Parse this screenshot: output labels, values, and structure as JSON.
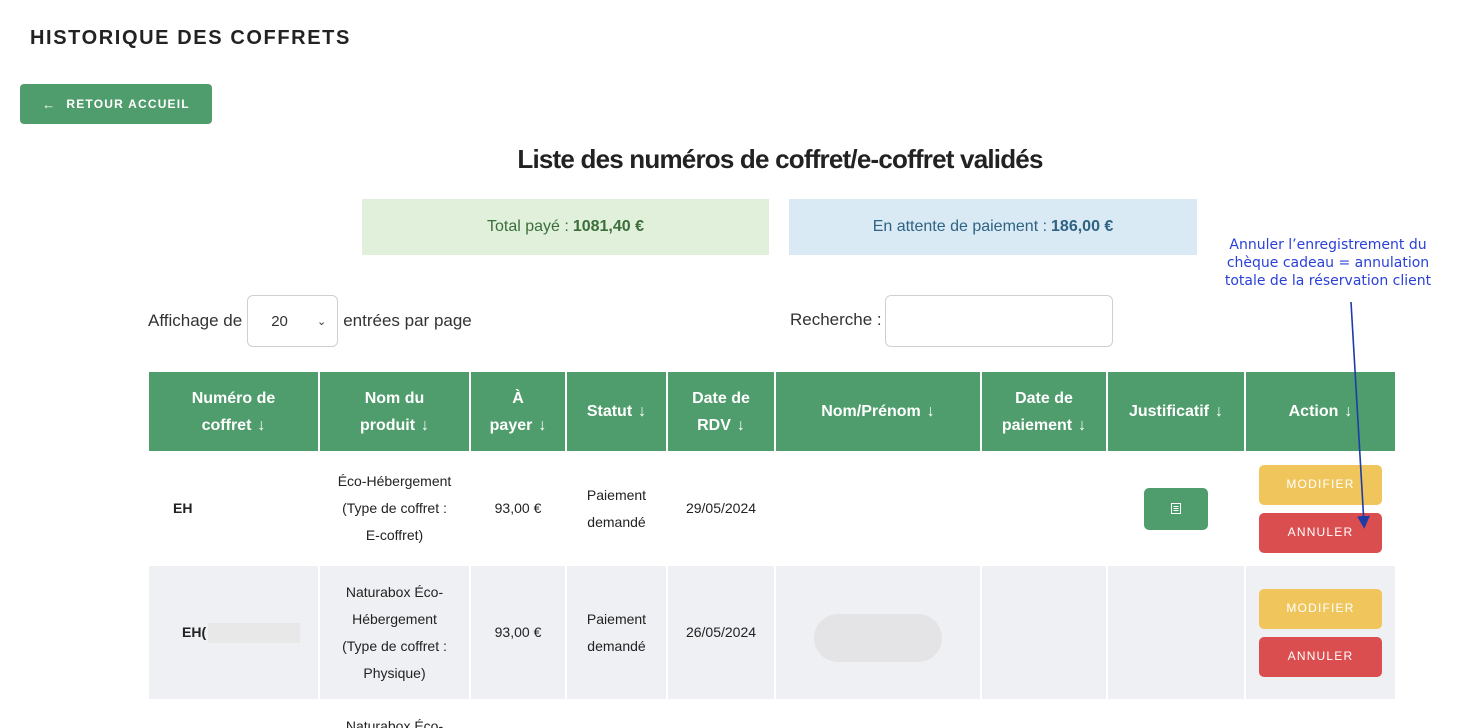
{
  "page": {
    "title": "HISTORIQUE DES COFFRETS",
    "back_button": {
      "arrow": "←",
      "label": "RETOUR ACCUEIL"
    },
    "list_title": "Liste des numéros de coffret/e-coffret validés"
  },
  "stats": {
    "paid_label": "Total payé :",
    "paid_value": "1081,40 €",
    "pending_label": "En attente de paiement :",
    "pending_value": "186,00 €"
  },
  "annotation": {
    "line1": "Annuler l’enregistrement du",
    "line2": "chèque cadeau = annulation",
    "line3": "totale de la réservation client",
    "color": "#2a40d8"
  },
  "controls": {
    "entries_prefix": "Affichage de",
    "entries_value": "20",
    "entries_suffix": "entrées par page",
    "search_label": "Recherche :",
    "search_value": ""
  },
  "table": {
    "sort_icon": "↓",
    "headers": [
      {
        "l1": "Numéro de",
        "l2": "coffret"
      },
      {
        "l1": "Nom du",
        "l2": "produit"
      },
      {
        "l1": "À",
        "l2": "payer"
      },
      {
        "l1": "Statut",
        "l2": ""
      },
      {
        "l1": "Date de",
        "l2": "RDV"
      },
      {
        "l1": "Nom/Prénom",
        "l2": ""
      },
      {
        "l1": "Date de",
        "l2": "paiement"
      },
      {
        "l1": "Justificatif",
        "l2": ""
      },
      {
        "l1": "Action",
        "l2": ""
      }
    ],
    "rows": [
      {
        "code": "EH",
        "product": [
          "Éco-Hébergement",
          "(Type de coffret :",
          "E-coffret)"
        ],
        "amount": "93,00 €",
        "status": [
          "Paiement",
          "demandé"
        ],
        "rdv": "29/05/2024",
        "name": "",
        "payment_date": "",
        "doc_icon": "document-icon",
        "modify": "MODIFIER",
        "cancel": "ANNULER"
      },
      {
        "code": "EH(",
        "product": [
          "Naturabox Éco-",
          "Hébergement",
          "(Type de coffret :",
          "Physique)"
        ],
        "amount": "93,00 €",
        "status": [
          "Paiement",
          "demandé"
        ],
        "rdv": "26/05/2024",
        "name": "",
        "payment_date": "",
        "modify": "MODIFIER",
        "cancel": "ANNULER"
      },
      {
        "product": [
          "Naturabox Éco-"
        ]
      }
    ]
  },
  "colors": {
    "primary_green": "#4f9c6c",
    "modify_yellow": "#f0c65c",
    "cancel_red": "#db4e4f",
    "paid_bg": "#e0f0da",
    "pending_bg": "#d9eaf5"
  }
}
